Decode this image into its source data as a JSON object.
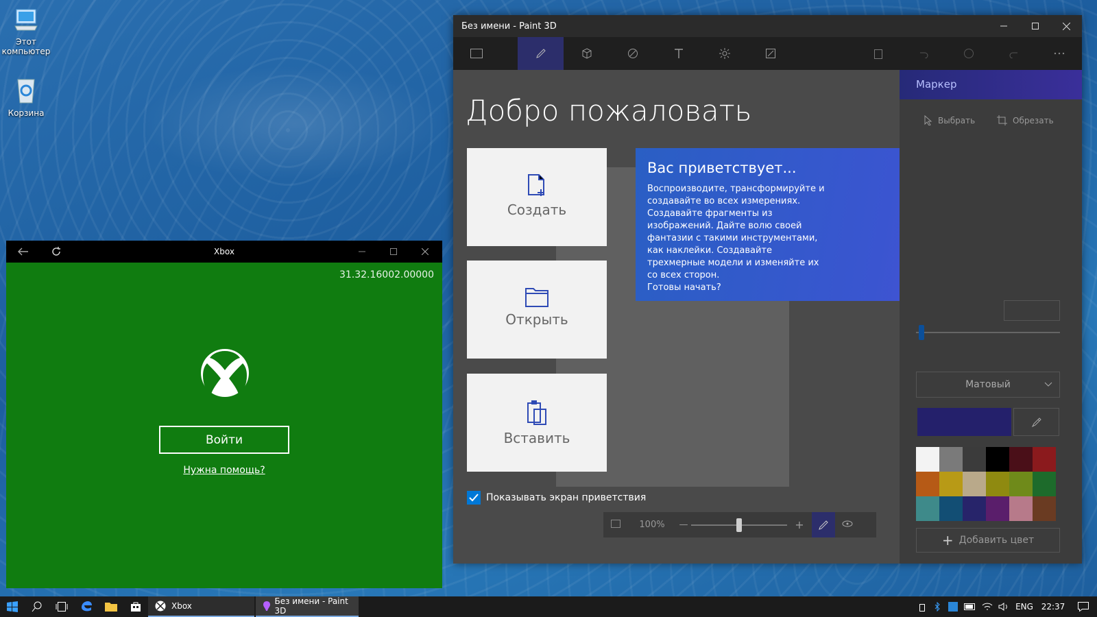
{
  "desktop": {
    "icons": [
      {
        "label": "Этот компьютер"
      },
      {
        "label": "Корзина"
      }
    ]
  },
  "xbox": {
    "title": "Xbox",
    "version": "31.32.16002.00000",
    "signin_label": "Войти",
    "help_label": "Нужна помощь?"
  },
  "paint": {
    "title": "Без имени - Paint 3D",
    "welcome_heading": "Добро пожаловать",
    "cards": [
      {
        "label": "Создать"
      },
      {
        "label": "Открыть"
      },
      {
        "label": "Вставить"
      }
    ],
    "intro_title": "Вас приветствует...",
    "intro_text": "Воспроизводите, трансформируйте и создавайте во всех измерениях. Создавайте фрагменты из изображений. Дайте волю своей фантазии с такими инструментами, как наклейки. Создавайте трехмерные модели и изменяйте их со всех сторон.",
    "intro_cta": "Готовы начать?",
    "show_welcome_label": "Показывать экран приветствия",
    "show_welcome_checked": true,
    "zoom": "100%",
    "panel": {
      "header": "Маркер",
      "select_label": "Выбрать",
      "crop_label": "Обрезать",
      "finish": "Матовый",
      "add_color_label": "Добавить цвет",
      "current_color": "#24206b",
      "palette": [
        "#f3f3f3",
        "#7a7a7a",
        "#3b3b3b",
        "#000000",
        "#4a0f18",
        "#8b1a1d",
        "#b65a16",
        "#b89a16",
        "#b9a98a",
        "#8f8a10",
        "#6f8a1a",
        "#1d6b2b",
        "#3e8a8a",
        "#124e74",
        "#27246a",
        "#5a1e6b",
        "#b77a8a",
        "#6a3b22"
      ]
    }
  },
  "taskbar": {
    "apps": [
      {
        "label": "Xbox"
      },
      {
        "label": "Без имени - Paint 3D"
      }
    ],
    "lang": "ENG",
    "time": "22:37"
  },
  "colors": {
    "xbox_green": "#107c10",
    "paint_accent": "#2c2e6b",
    "intro_blue": "#2563c8"
  }
}
